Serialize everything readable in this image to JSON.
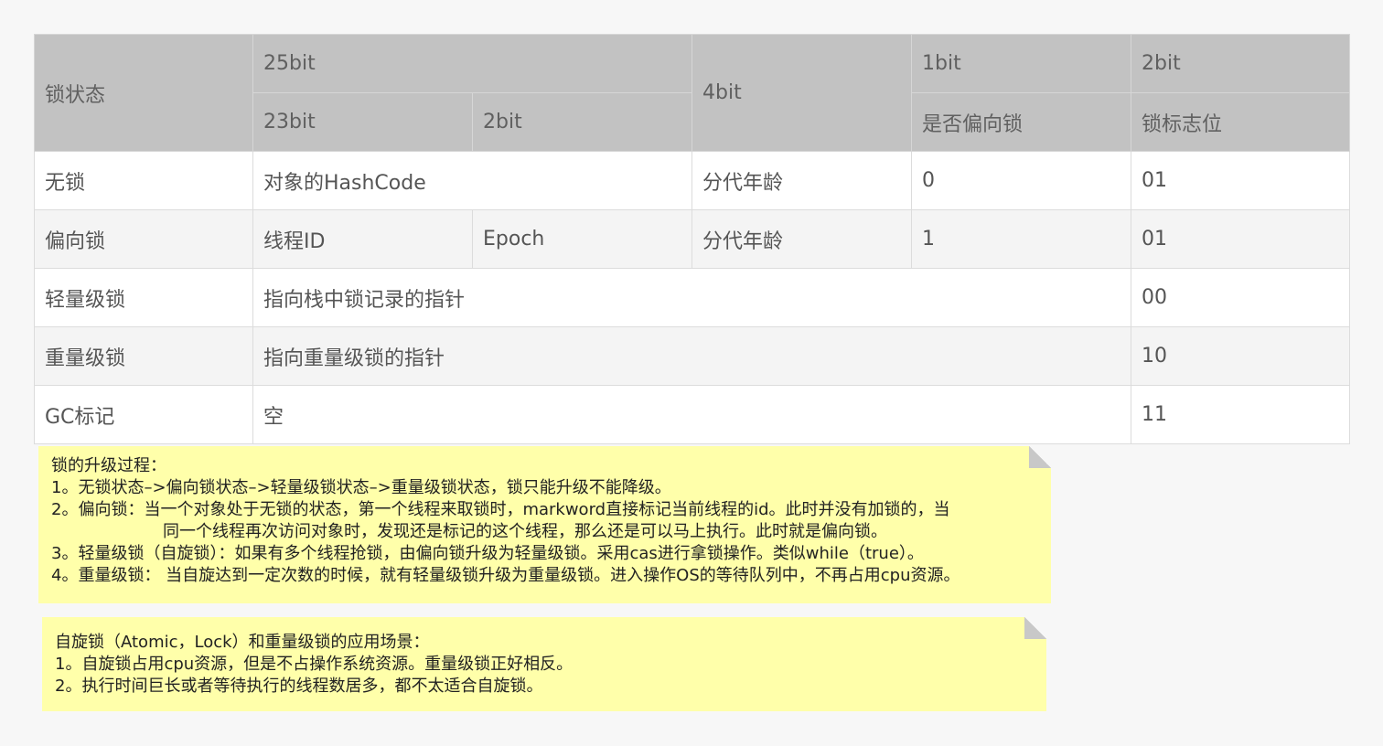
{
  "table": {
    "header_row1": {
      "lock_state": "锁状态",
      "bits25": "25bit",
      "bits4": "4bit",
      "bits1": "1bit",
      "bits2": "2bit"
    },
    "header_row2": {
      "bits23": "23bit",
      "bits2": "2bit",
      "biased_flag": "是否偏向锁",
      "lock_flag": "锁标志位"
    },
    "rows": [
      {
        "state": "无锁",
        "col1": "对象的HashCode",
        "age": "分代年龄",
        "biased": "0",
        "flag": "01"
      },
      {
        "state": "偏向锁",
        "thread_id": "线程ID",
        "epoch": "Epoch",
        "age": "分代年龄",
        "biased": "1",
        "flag": "01"
      },
      {
        "state": "轻量级锁",
        "content": "指向栈中锁记录的指针",
        "flag": "00"
      },
      {
        "state": "重量级锁",
        "content": "指向重量级锁的指针",
        "flag": "10"
      },
      {
        "state": "GC标记",
        "content": "空",
        "flag": "11"
      }
    ]
  },
  "note1": {
    "lines": [
      "锁的升级过程：",
      "1。无锁状态–>偏向锁状态–>轻量级锁状态–>重量级锁状态，锁只能升级不能降级。",
      "2。偏向锁：当一个对象处于无锁的状态，第一个线程来取锁时，markword直接标记当前线程的id。此时并没有加锁的，当",
      "同一个线程再次访问对象时，发现还是标记的这个线程，那么还是可以马上执行。此时就是偏向锁。",
      "3。轻量级锁（自旋锁）：如果有多个线程抢锁，由偏向锁升级为轻量级锁。采用cas进行拿锁操作。类似while（true）。",
      "4。重量级锁： 当自旋达到一定次数的时候，就有轻量级锁升级为重量级锁。进入操作OS的等待队列中，不再占用cpu资源。"
    ]
  },
  "note2": {
    "lines": [
      "自旋锁（Atomic，Lock）和重量级锁的应用场景：",
      "1。自旋锁占用cpu资源，但是不占操作系统资源。重量级锁正好相反。",
      "2。执行时间巨长或者等待执行的线程数居多，都不太适合自旋锁。"
    ]
  }
}
